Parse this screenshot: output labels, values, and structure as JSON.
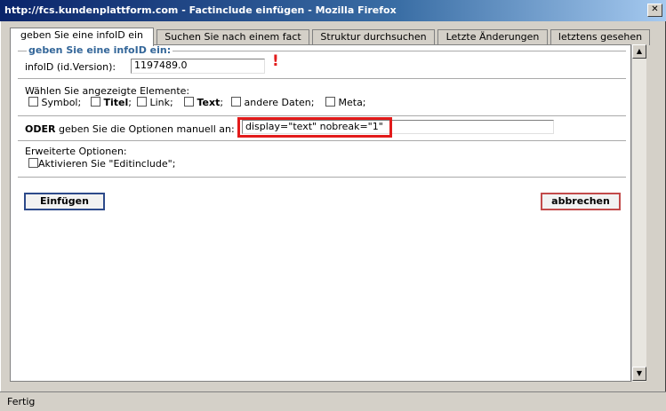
{
  "window": {
    "title": "http://fcs.kundenplattform.com - Factinclude einfügen - Mozilla Firefox",
    "close_glyph": "✕"
  },
  "tabs": [
    {
      "label": "geben Sie eine infoID ein",
      "active": true
    },
    {
      "label": "Suchen Sie nach einem fact",
      "active": false
    },
    {
      "label": "Struktur durchsuchen",
      "active": false
    },
    {
      "label": "Letzte Änderungen",
      "active": false
    },
    {
      "label": "letztens gesehen",
      "active": false
    }
  ],
  "form": {
    "legend": "geben Sie eine infoID ein:",
    "infoid_label": "infoID (id.Version):",
    "infoid_value": "1197489.0",
    "required_mark": "!",
    "elements_label": "Wählen Sie angezeigte Elemente:",
    "checkboxes": {
      "symbol": "Symbol;",
      "titel": "Titel",
      "titel_suffix": ";",
      "link": "Link;",
      "text": "Text",
      "text_suffix": ";",
      "andere": "andere Daten;",
      "meta": "Meta;"
    },
    "oder_bold": "ODER",
    "oder_rest": " geben Sie die Optionen manuell an:",
    "options_value": "display=\"text\" nobreak=\"1\"",
    "erweiterte_label": "Erweiterte Optionen:",
    "editinclude_label": "Aktivieren Sie \"Editinclude\";"
  },
  "buttons": {
    "insert": "Einfügen",
    "cancel": "abbrechen"
  },
  "statusbar": {
    "text": "Fertig"
  },
  "colors": {
    "highlight": "#e21b1b",
    "legend": "#336699",
    "required": "#e21b1b"
  }
}
